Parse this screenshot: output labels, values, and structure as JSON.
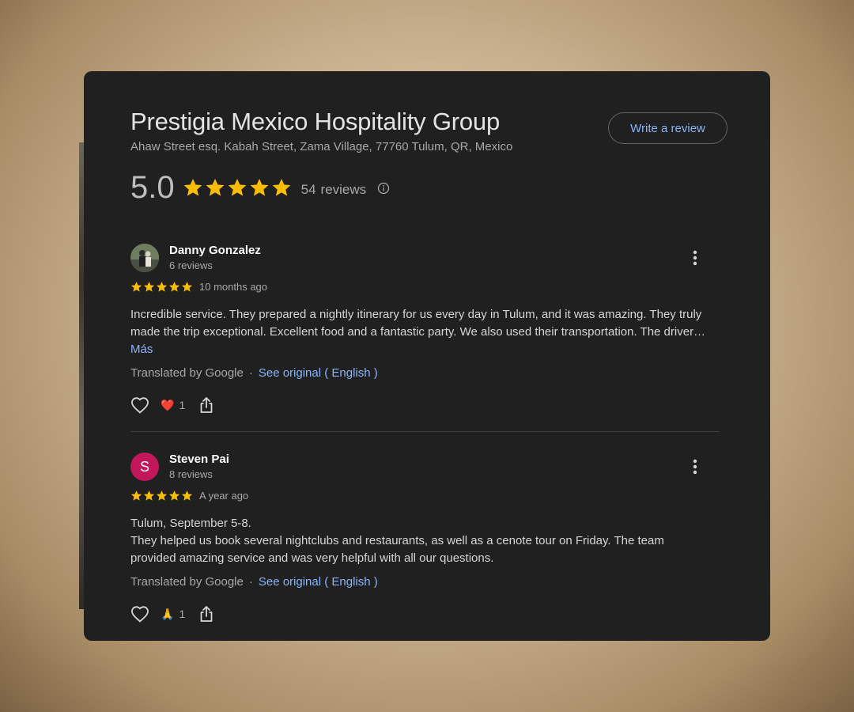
{
  "business": {
    "name": "Prestigia Mexico Hospitality Group",
    "address": "Ahaw Street esq. Kabah Street, Zama Village, 77760 Tulum, QR, Mexico",
    "write_review_label": "Write a review",
    "rating": "5.0",
    "stars": 5,
    "review_count": "54",
    "reviews_label": "reviews"
  },
  "colors": {
    "star": "#fbbc04",
    "link": "#8ab4f8",
    "avatar_steven": "#c2185b"
  },
  "reviews": [
    {
      "name": "Danny Gonzalez",
      "review_count": "6 reviews",
      "stars": 5,
      "date": "10 months ago",
      "text": "Incredible service. They prepared a nightly itinerary for us every day in Tulum, and it was amazing. They truly made the trip exceptional. Excellent food and a fantastic party. We also used their transportation. The driver…",
      "more_label": "Más",
      "translated_by": "Translated by Google",
      "separator": "·",
      "see_original": "See original ( English )",
      "reaction_emoji": "❤️",
      "reaction_icon": "heart-emoji",
      "reaction_count": "1"
    },
    {
      "name": "Steven Pai",
      "avatar_letter": "S",
      "review_count": "8 reviews",
      "stars": 5,
      "date": "A year ago",
      "text_line1": "Tulum, September 5-8.",
      "text_line2": "They helped us book several nightclubs and restaurants, as well as a cenote tour on Friday. The team provided amazing service and was very helpful with all our questions.",
      "translated_by": "Translated by Google",
      "separator": "·",
      "see_original": "See original ( English )",
      "reaction_emoji": "🙏",
      "reaction_icon": "folded-hands-emoji",
      "reaction_count": "1"
    }
  ]
}
